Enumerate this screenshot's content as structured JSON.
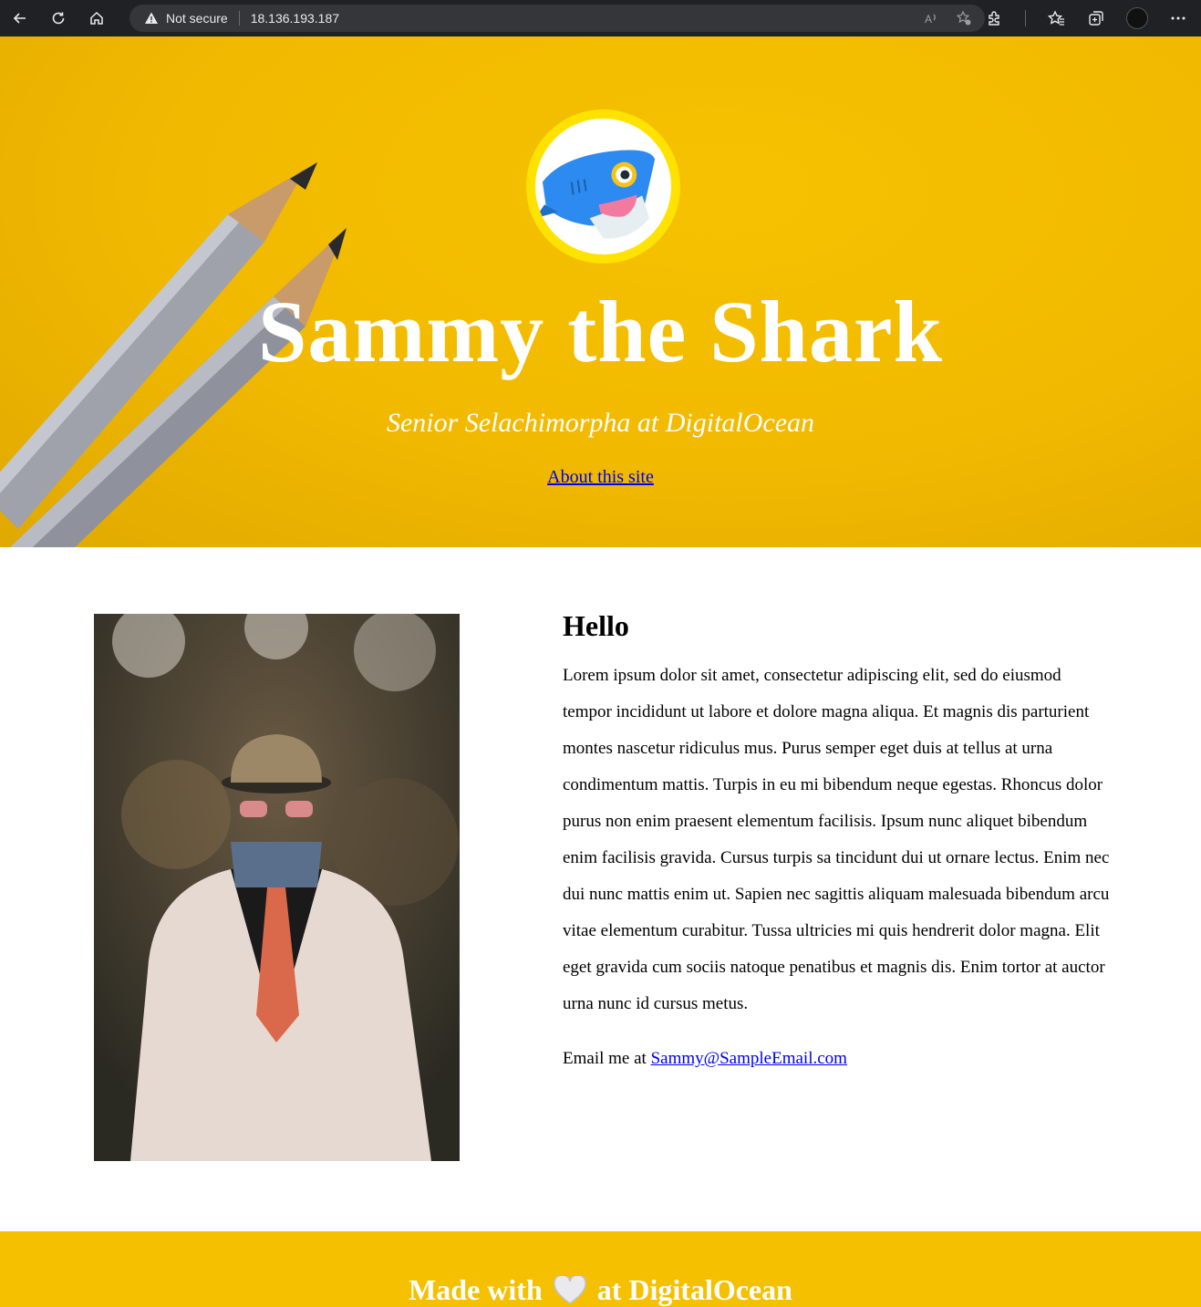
{
  "browser": {
    "security_label": "Not secure",
    "url": "18.136.193.187",
    "icons": [
      "back-icon",
      "refresh-icon",
      "home-icon",
      "warning-icon",
      "read-aloud-icon",
      "add-favorite-icon",
      "extensions-icon",
      "favorites-icon",
      "collections-icon",
      "profile-avatar",
      "more-icon"
    ]
  },
  "hero": {
    "title": "Sammy the Shark",
    "subtitle": "Senior Selachimorpha at DigitalOcean",
    "link": "About this site",
    "colors": {
      "background": "#f3bd00",
      "avatar_ring": "#ffe200",
      "text": "#ffffff"
    }
  },
  "main": {
    "heading": "Hello",
    "body": "Lorem ipsum dolor sit amet, consectetur adipiscing elit, sed do eiusmod tempor incididunt ut labore et dolore magna aliqua. Et magnis dis parturient montes nascetur ridiculus mus. Purus semper eget duis at tellus at urna condimentum mattis. Turpis in eu mi bibendum neque egestas. Rhoncus dolor purus non enim praesent elementum facilisis. Ipsum nunc aliquet bibendum enim facilisis gravida. Cursus turpis sa tincidunt dui ut ornare lectus. Enim nec dui nunc mattis enim ut. Sapien nec sagittis aliquam malesuada bibendum arcu vitae elementum curabitur. Tussa ultricies mi quis hendrerit dolor magna. Elit eget gravida cum sociis natoque penatibus et magnis dis. Enim tortor at auctor urna nunc id cursus metus.",
    "email_prefix": "Email me at",
    "email": "Sammy@SampleEmail.com"
  },
  "footer": {
    "text_before": "Made with",
    "text_after": "at DigitalOcean",
    "colors": {
      "background": "#f5c000",
      "text": "#ffffff"
    }
  }
}
